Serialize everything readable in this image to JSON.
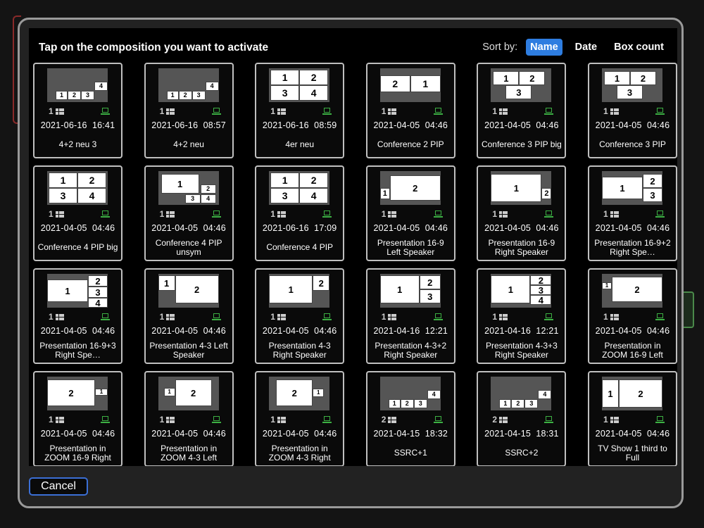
{
  "dialog": {
    "title": "Tap on the composition you want to activate",
    "sort": {
      "label": "Sort by:",
      "options": [
        {
          "label": "Name",
          "active": true
        },
        {
          "label": "Date",
          "active": false
        },
        {
          "label": "Box count",
          "active": false
        }
      ]
    },
    "cancel_label": "Cancel"
  },
  "colors": {
    "accent": "#2e7de0",
    "laptop": "#3cb043"
  },
  "icons": {
    "count": "grid-icon",
    "source": "laptop-icon"
  },
  "compositions": [
    {
      "name": "4+2 neu 3",
      "count": "1",
      "datetime": "2021-06-16  16:41"
    },
    {
      "name": "4+2 neu",
      "count": "1",
      "datetime": "2021-06-16  08:57"
    },
    {
      "name": "4er neu",
      "count": "1",
      "datetime": "2021-06-16  08:59"
    },
    {
      "name": "Conference 2 PIP",
      "count": "1",
      "datetime": "2021-04-05  04:46"
    },
    {
      "name": "Conference 3 PIP big",
      "count": "1",
      "datetime": "2021-04-05  04:46"
    },
    {
      "name": "Conference 3 PIP",
      "count": "1",
      "datetime": "2021-04-05  04:46"
    },
    {
      "name": "Conference 4 PIP big",
      "count": "1",
      "datetime": "2021-04-05  04:46"
    },
    {
      "name": "Conference 4 PIP unsym",
      "count": "1",
      "datetime": "2021-04-05  04:46"
    },
    {
      "name": "Conference 4 PIP",
      "count": "1",
      "datetime": "2021-06-16  17:09"
    },
    {
      "name": "Presentation 16-9 Left Speaker",
      "count": "1",
      "datetime": "2021-04-05  04:46"
    },
    {
      "name": "Presentation 16-9 Right Speaker",
      "count": "1",
      "datetime": "2021-04-05  04:46"
    },
    {
      "name": "Presentation 16-9+2 Right Spe…",
      "count": "1",
      "datetime": "2021-04-05  04:46"
    },
    {
      "name": "Presentation 16-9+3 Right Spe…",
      "count": "1",
      "datetime": "2021-04-05  04:46"
    },
    {
      "name": "Presentation 4-3 Left Speaker",
      "count": "1",
      "datetime": "2021-04-05  04:46"
    },
    {
      "name": "Presentation 4-3 Right Speaker",
      "count": "1",
      "datetime": "2021-04-05  04:46"
    },
    {
      "name": "Presentation 4-3+2 Right Speaker",
      "count": "1",
      "datetime": "2021-04-16  12:21"
    },
    {
      "name": "Presentation 4-3+3 Right Speaker",
      "count": "1",
      "datetime": "2021-04-16  12:21"
    },
    {
      "name": "Presentation in ZOOM 16-9 Left",
      "count": "1",
      "datetime": "2021-04-05  04:46"
    },
    {
      "name": "Presentation in ZOOM 16-9 Right",
      "count": "1",
      "datetime": "2021-04-05  04:46"
    },
    {
      "name": "Presentation in ZOOM 4-3 Left",
      "count": "1",
      "datetime": "2021-04-05  04:46"
    },
    {
      "name": "Presentation in ZOOM 4-3 Right",
      "count": "1",
      "datetime": "2021-04-05  04:46"
    },
    {
      "name": "SSRC+1",
      "count": "2",
      "datetime": "2021-04-15  18:32"
    },
    {
      "name": "SSRC+2",
      "count": "2",
      "datetime": "2021-04-15  18:31"
    },
    {
      "name": "TV Show 1 third to Full",
      "count": "1",
      "datetime": "2021-04-05  04:46"
    }
  ],
  "thumbnail_labels": [
    [
      "1",
      "2",
      "3",
      "4"
    ],
    [
      "1",
      "2",
      "3",
      "4"
    ],
    [
      "1",
      "2",
      "3",
      "4"
    ],
    [
      "2",
      "1"
    ],
    [
      "1",
      "2",
      "3"
    ],
    [
      "1",
      "2",
      "3"
    ],
    [
      "1",
      "2",
      "3",
      "4"
    ],
    [
      "1",
      "2",
      "3",
      "4"
    ],
    [
      "1",
      "2",
      "3",
      "4"
    ],
    [
      "1",
      "2"
    ],
    [
      "1",
      "2"
    ],
    [
      "1",
      "2",
      "3"
    ],
    [
      "1",
      "2",
      "3",
      "4"
    ],
    [
      "1",
      "2"
    ],
    [
      "1",
      "2"
    ],
    [
      "1",
      "2",
      "3"
    ],
    [
      "1",
      "2",
      "3",
      "4"
    ],
    [
      "1",
      "2"
    ],
    [
      "2",
      "1"
    ],
    [
      "1",
      "2"
    ],
    [
      "2",
      "1"
    ],
    [
      "1",
      "2",
      "3",
      "4"
    ],
    [
      "1",
      "2",
      "3",
      "4"
    ],
    [
      "1",
      "2"
    ]
  ]
}
